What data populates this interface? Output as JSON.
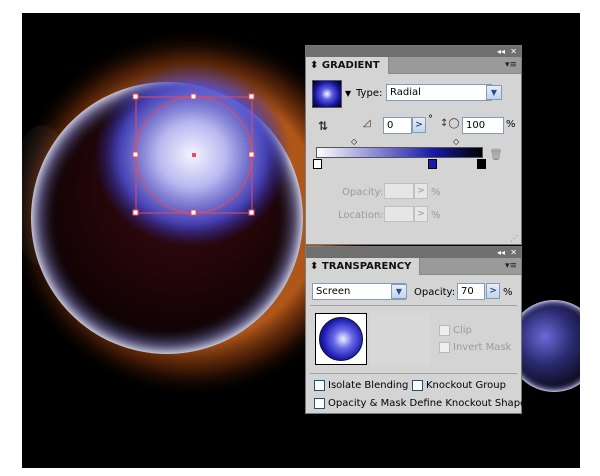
{
  "gradient_panel": {
    "title": "GRADIENT",
    "type_label": "Type:",
    "type_value": "Radial",
    "angle_value": "0",
    "angle_unit": "°",
    "aspect_value": "100",
    "aspect_unit": "%",
    "opacity_label": "Opacity:",
    "opacity_unit": "%",
    "location_label": "Location:",
    "location_unit": "%",
    "colors": {
      "start": "#ffffff",
      "mid": "#1a1aa8",
      "end": "#000000"
    }
  },
  "transparency_panel": {
    "title": "TRANSPARENCY",
    "blend_mode": "Screen",
    "opacity_label": "Opacity:",
    "opacity_value": "70",
    "opacity_unit": "%",
    "clip_label": "Clip",
    "invert_mask_label": "Invert Mask",
    "isolate_blending_label": "Isolate Blending",
    "knockout_group_label": "Knockout Group",
    "opacity_mask_label": "Opacity & Mask Define Knockout Shape"
  },
  "panel_controls": {
    "collapse_glyph": "◂◂",
    "close_glyph": "✕",
    "menu_glyph": "▾≡"
  }
}
